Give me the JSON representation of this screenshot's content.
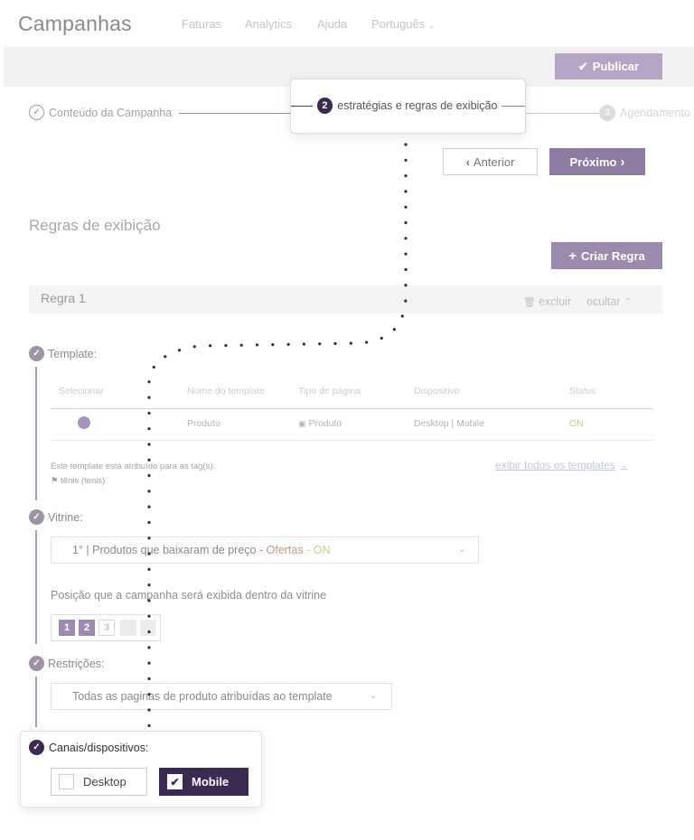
{
  "app": {
    "title": "Campanhas",
    "nav": [
      "Faturas",
      "Analytics",
      "Ajuda",
      "Português"
    ]
  },
  "toolbar": {
    "publish_label": "Publicar"
  },
  "stepper": {
    "steps": [
      {
        "number": "",
        "label": "Conteúdo da Campanha",
        "state": "done"
      },
      {
        "number": "2",
        "label": "estratégias e regras de exibição",
        "state": "active"
      },
      {
        "number": "3",
        "label": "Agendamento",
        "state": "pending"
      }
    ]
  },
  "actions": {
    "prev_label": "Anterior",
    "next_label": "Próximo"
  },
  "rules_section": {
    "title": "Regras de exibição",
    "create_label": "Criar Regra",
    "rule": {
      "title": "Regra 1",
      "delete_label": "excluir",
      "hide_label": "ocultar"
    }
  },
  "template": {
    "label": "Template:",
    "columns": [
      "Selecionar",
      "Nome do template",
      "Tipo de página",
      "Dispositivo",
      "Status"
    ],
    "rows": [
      {
        "name": "Produto",
        "page_type": "Produto",
        "device": "Desktop | Mobile",
        "status": "ON"
      }
    ],
    "tag_note": "Este template está atribuído para as tag(s):",
    "tag": "tênis (tenis)",
    "show_all_label": "exibir todos os templates"
  },
  "vitrine": {
    "label": "Vitrine:",
    "selected_prefix": "1° | Produtos que baixaram de preço - ",
    "selected_offer": "Ofertas",
    "selected_sep": " - ",
    "selected_status": "ON",
    "position_label": "Posição que a campanha será exibida dentro da vitrine",
    "positions": [
      {
        "label": "1",
        "state": "selected"
      },
      {
        "label": "2",
        "state": "selected"
      },
      {
        "label": "3",
        "state": "available"
      },
      {
        "label": "",
        "state": "disabled"
      },
      {
        "label": "",
        "state": "disabled"
      }
    ]
  },
  "restricoes": {
    "label": "Restrições:",
    "selected": "Todas as paginas de produto atribuídas ao template"
  },
  "canais": {
    "label": "Canais/dispositivos:",
    "desktop_label": "Desktop",
    "mobile_label": "Mobile",
    "desktop_checked": false,
    "mobile_checked": true
  },
  "colors": {
    "brand_dark": "#3b2a52",
    "brand_mid": "#8d7ba1",
    "brand_light": "#b3a5c3",
    "status_on": "#c9cf8a",
    "link": "#c0c7dc"
  }
}
